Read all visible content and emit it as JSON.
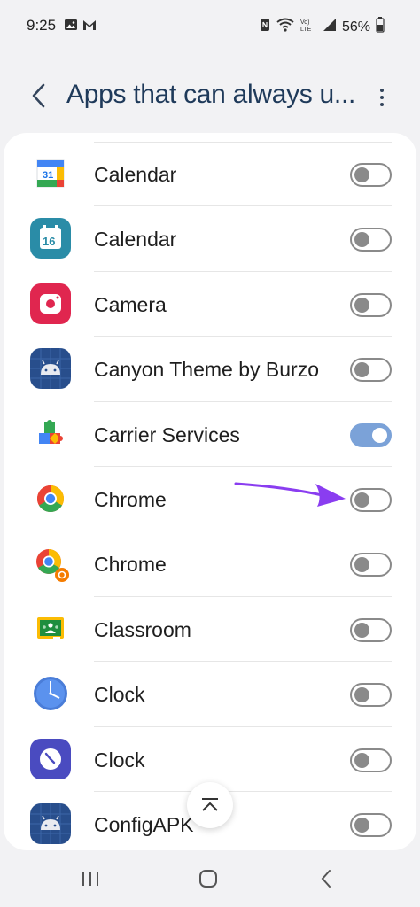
{
  "status_bar": {
    "time": "9:25",
    "battery": "56%",
    "left_icons": [
      "image-icon",
      "gmail-icon"
    ],
    "right_icons": [
      "nfc-icon",
      "wifi-icon",
      "volte-icon",
      "signal-icon",
      "battery-icon"
    ]
  },
  "header": {
    "title": "Apps that can always u...",
    "back_icon": "back-chevron-icon",
    "more_icon": "more-vert-icon"
  },
  "colors": {
    "accent": "#7ba2d8",
    "title": "#1f3a5a",
    "arrow": "#8a3df0"
  },
  "apps": [
    {
      "label": "Calendar",
      "icon": "google-calendar-icon",
      "enabled": false
    },
    {
      "label": "Calendar",
      "icon": "samsung-calendar-icon",
      "enabled": false
    },
    {
      "label": "Camera",
      "icon": "camera-icon",
      "enabled": false
    },
    {
      "label": "Canyon Theme by Burzo",
      "icon": "android-icon",
      "enabled": false
    },
    {
      "label": "Carrier Services",
      "icon": "carrier-services-icon",
      "enabled": true
    },
    {
      "label": "Chrome",
      "icon": "chrome-icon",
      "enabled": false
    },
    {
      "label": "Chrome",
      "icon": "chrome-badged-icon",
      "enabled": false
    },
    {
      "label": "Classroom",
      "icon": "classroom-icon",
      "enabled": false
    },
    {
      "label": "Clock",
      "icon": "google-clock-icon",
      "enabled": false
    },
    {
      "label": "Clock",
      "icon": "samsung-clock-icon",
      "enabled": false
    },
    {
      "label": "ConfigAPK",
      "icon": "android-icon",
      "enabled": false
    }
  ],
  "nav": {
    "recents_icon": "recents-icon",
    "home_icon": "home-icon",
    "back_icon": "back-icon"
  }
}
